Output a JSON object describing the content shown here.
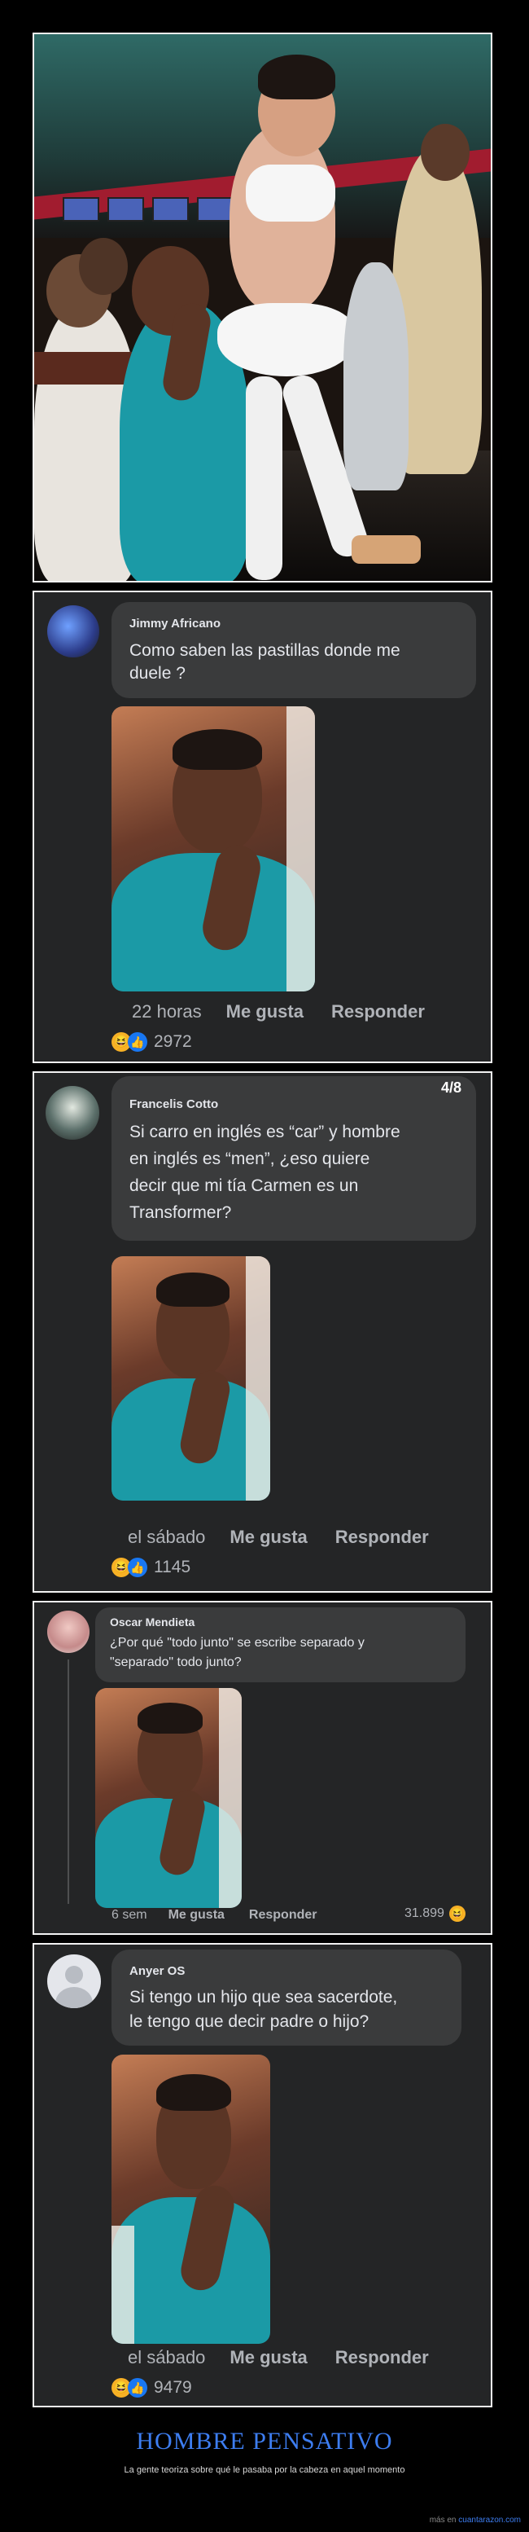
{
  "comments": [
    {
      "author": "Jimmy Africano",
      "text": [
        "Como saben las pastillas donde me",
        "duele ?"
      ],
      "time": "22 horas",
      "like_label": "Me gusta",
      "reply_label": "Responder",
      "reaction_count": "2972",
      "icons": [
        "haha-icon",
        "like-icon"
      ]
    },
    {
      "author": "Francelis Cotto",
      "badge": "4/8",
      "text": [
        "Si carro en inglés es “car” y hombre",
        "en inglés es “men”, ¿eso quiere",
        "decir que mi tía Carmen es un",
        "Transformer?"
      ],
      "time": "el sábado",
      "like_label": "Me gusta",
      "reply_label": "Responder",
      "reaction_count": "1145",
      "icons": [
        "haha-icon",
        "like-icon"
      ]
    },
    {
      "author": "Oscar Mendieta",
      "text": [
        "¿Por qué \"todo junto\" se escribe separado y",
        "\"separado\" todo junto?"
      ],
      "time": "6 sem",
      "like_label": "Me gusta",
      "reply_label": "Responder",
      "reaction_count": "31.899",
      "icons": [
        "haha-icon"
      ]
    },
    {
      "author": "Anyer OS",
      "text": [
        "Si tengo un hijo que sea sacerdote,",
        "le tengo que decir padre o hijo?"
      ],
      "time": "el sábado",
      "like_label": "Me gusta",
      "reply_label": "Responder",
      "reaction_count": "9479",
      "icons": [
        "haha-icon",
        "like-icon"
      ]
    }
  ],
  "footer": {
    "title": "HOMBRE PENSATIVO",
    "subtitle": "La gente teoriza sobre qué le pasaba por la cabeza en aquel momento",
    "credit_prefix": "más en",
    "credit_link": "cuantarazon.com"
  },
  "colors": {
    "panel_bg": "#242526",
    "bubble_bg": "#3a3b3c",
    "title_blue": "#3d7df0",
    "haha": "#f7b125",
    "like": "#1877f2"
  }
}
